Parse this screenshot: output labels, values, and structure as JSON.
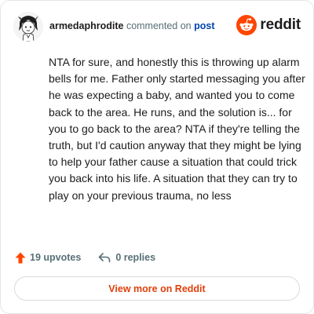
{
  "header": {
    "username": "armedaphrodite",
    "action_text": " commented on ",
    "post_link": "post",
    "brand": "reddit"
  },
  "comment": {
    "text": "NTA for sure, and honestly this is throwing up alarm bells for me. Father only started messaging you after he was expecting a baby, and wanted you to come back to the area. He runs, and the solution is... for you to go back to the area? NTA if they're telling the truth, but I'd caution anyway that they might be lying to help your father cause a situation that could trick you back into his life. A situation that they can try to play on your previous trauma, no less"
  },
  "actions": {
    "upvotes": "19 upvotes",
    "replies": "0 replies"
  },
  "footer": {
    "view_more": "View more on Reddit"
  },
  "colors": {
    "brand_orange": "#ff4500",
    "link_blue": "#0045ac",
    "button_text": "#e0410b"
  },
  "icons": {
    "avatar": "user-avatar",
    "logo": "reddit-snoo-icon",
    "upvote": "upvote-arrow-icon",
    "reply": "reply-arrow-icon"
  }
}
